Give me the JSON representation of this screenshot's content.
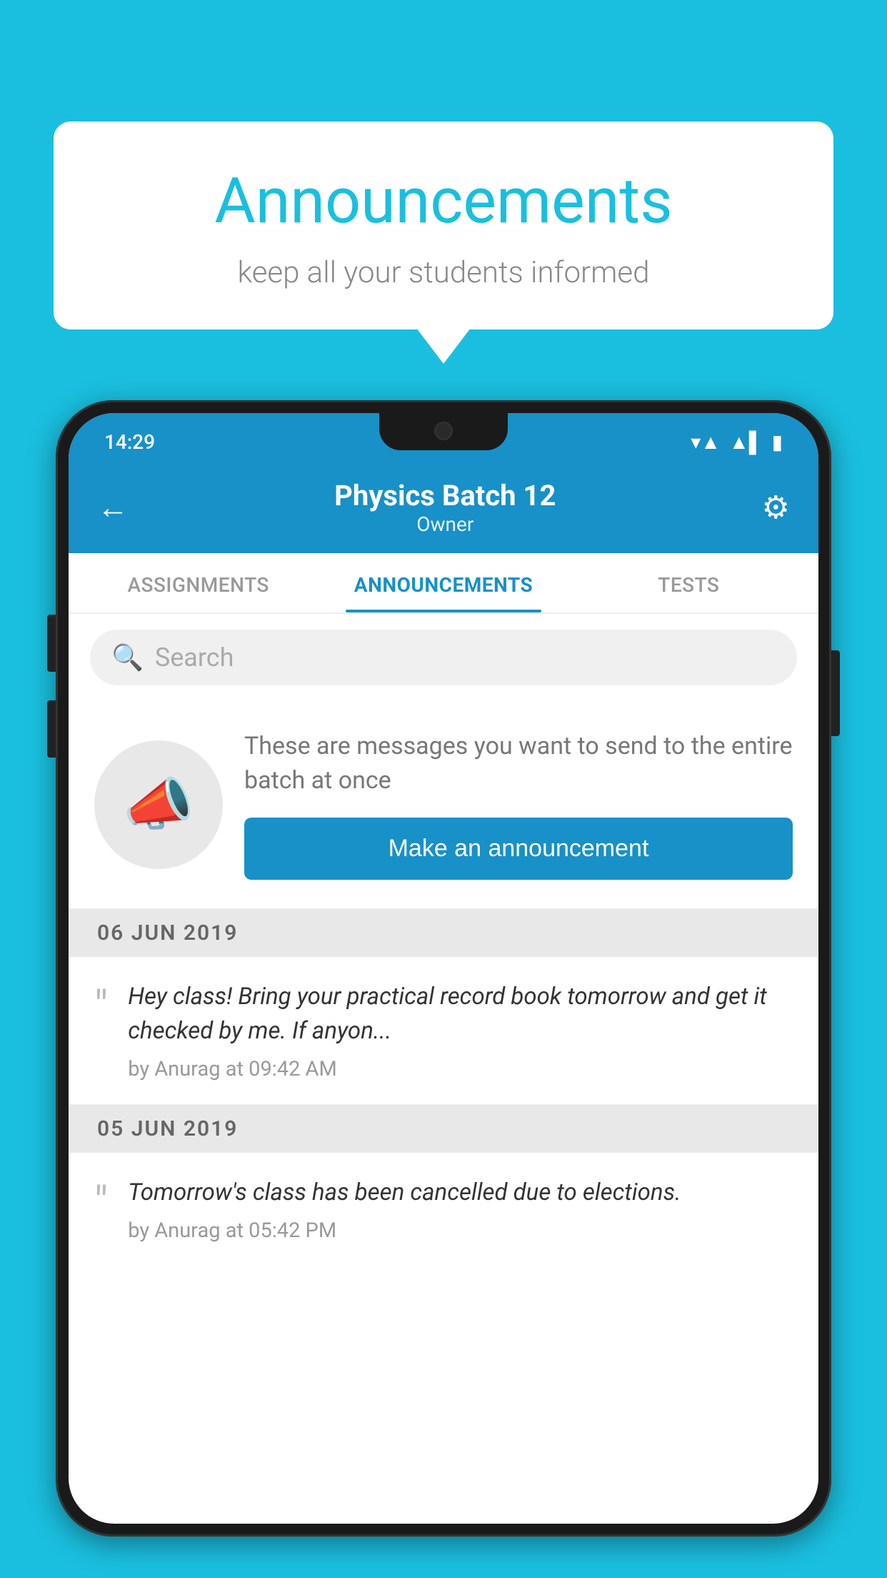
{
  "bubble": {
    "title": "Announcements",
    "subtitle": "keep all your students informed"
  },
  "statusBar": {
    "time": "14:29",
    "wifi": "wifi",
    "signal": "signal",
    "battery": "battery"
  },
  "header": {
    "title": "Physics Batch 12",
    "subtitle": "Owner",
    "backLabel": "←",
    "gearLabel": "⚙"
  },
  "tabs": [
    {
      "label": "ASSIGNMENTS",
      "active": false
    },
    {
      "label": "ANNOUNCEMENTS",
      "active": true
    },
    {
      "label": "TESTS",
      "active": false
    }
  ],
  "search": {
    "placeholder": "Search"
  },
  "announcementIntro": {
    "description": "These are messages you want to send to the entire batch at once",
    "buttonLabel": "Make an announcement"
  },
  "announcements": [
    {
      "date": "06  JUN  2019",
      "text": "Hey class! Bring your practical record book tomorrow and get it checked by me. If anyon...",
      "meta": "by Anurag at 09:42 AM"
    },
    {
      "date": "05  JUN  2019",
      "text": "Tomorrow's class has been cancelled due to elections.",
      "meta": "by Anurag at 05:42 PM"
    }
  ]
}
